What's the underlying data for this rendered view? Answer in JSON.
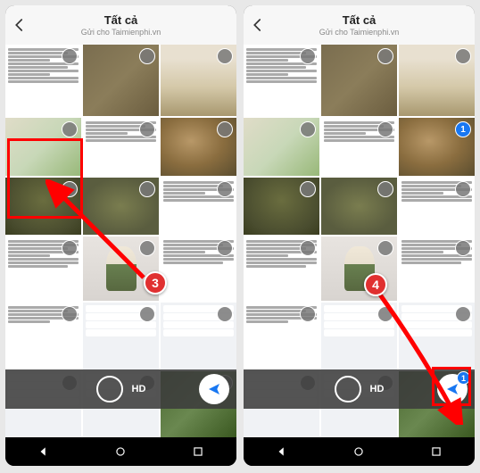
{
  "left": {
    "header": {
      "title": "Tất cả",
      "subtitle": "Gửi cho Taimienphi.vn"
    },
    "bottom": {
      "hd": "HD"
    },
    "callout": "3"
  },
  "right": {
    "header": {
      "title": "Tất cả",
      "subtitle": "Gửi cho Taimienphi.vn"
    },
    "bottom": {
      "hd": "HD"
    },
    "selected_number": "1",
    "send_badge": "1",
    "callout": "4"
  }
}
